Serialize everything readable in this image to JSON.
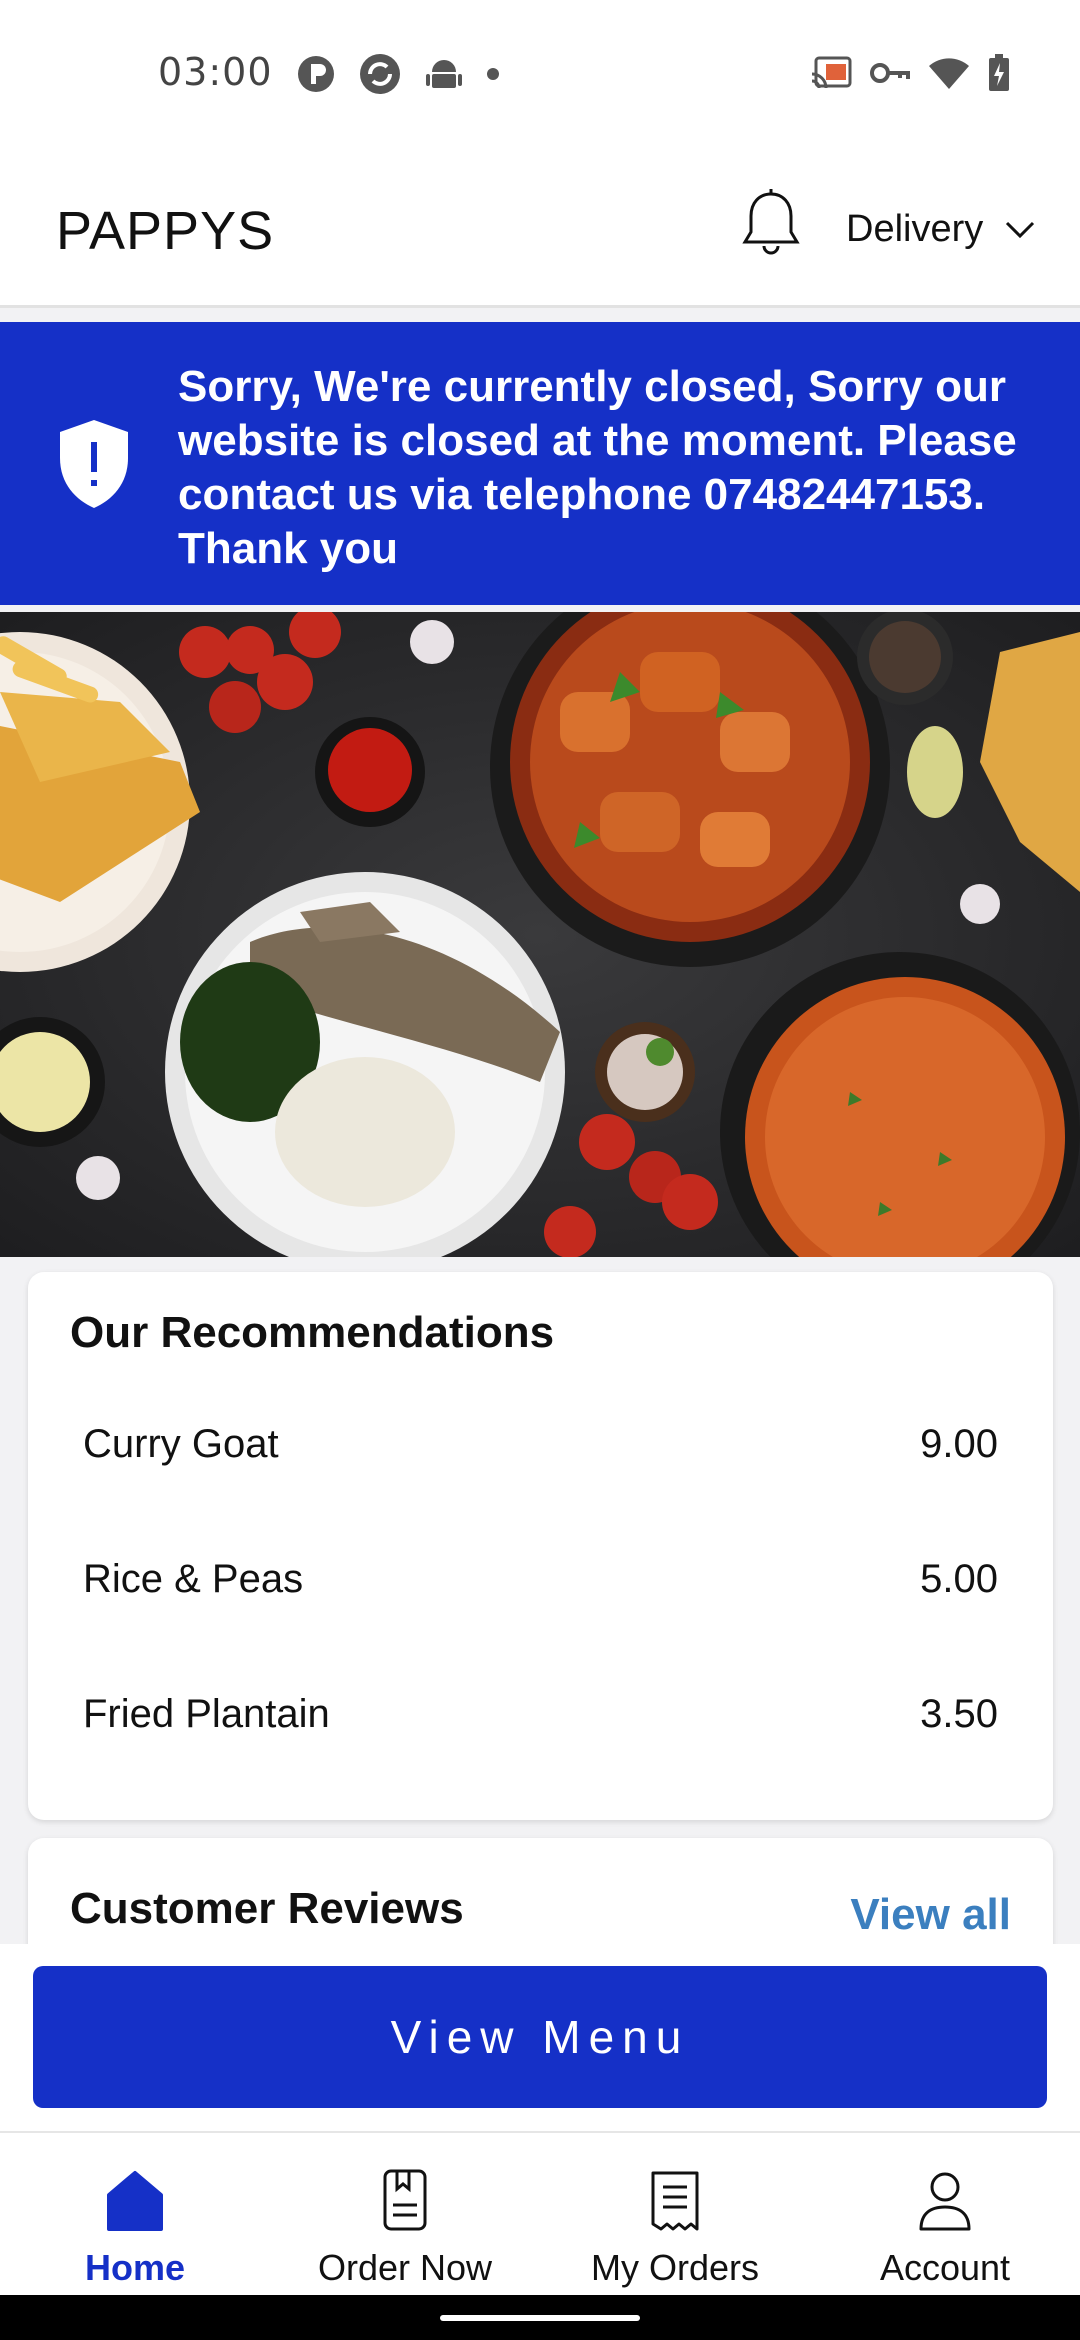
{
  "status_bar": {
    "time": "03:00",
    "left_icons": [
      "p-badge-icon",
      "sync-icon",
      "android-icon",
      "dot-icon"
    ],
    "right_icons": [
      "cast-icon",
      "vpn-key-icon",
      "wifi-icon",
      "battery-charging-icon"
    ]
  },
  "header": {
    "brand": "PAPPYS",
    "mode_label": "Delivery"
  },
  "closed_banner": {
    "message": "Sorry, We're currently closed, Sorry our website is closed at the moment. Please contact us via telephone 07482447153. Thank you"
  },
  "recommendations": {
    "title": "Our Recommendations",
    "items": [
      {
        "name": "Curry Goat",
        "price": "9.00"
      },
      {
        "name": "Rice & Peas",
        "price": "5.00"
      },
      {
        "name": "Fried Plantain",
        "price": "3.50"
      }
    ]
  },
  "reviews": {
    "title": "Customer Reviews",
    "view_all": "View all"
  },
  "view_menu_label": "View Menu",
  "nav": {
    "items": [
      {
        "label": "Home",
        "active": true
      },
      {
        "label": "Order Now",
        "active": false
      },
      {
        "label": "My Orders",
        "active": false
      },
      {
        "label": "Account",
        "active": false
      }
    ]
  },
  "colors": {
    "brand_blue": "#1530c7",
    "link_blue": "#3b7fbf"
  }
}
